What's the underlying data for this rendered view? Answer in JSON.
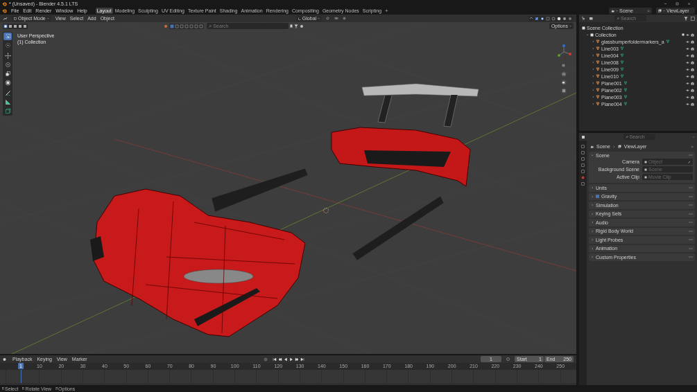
{
  "window": {
    "title": "* (Unsaved) - Blender 4.5.1 LTS"
  },
  "menu": [
    "File",
    "Edit",
    "Render",
    "Window",
    "Help"
  ],
  "workspaces": [
    {
      "label": "Layout",
      "selected": true
    },
    {
      "label": "Modeling",
      "selected": false
    },
    {
      "label": "Sculpting",
      "selected": false
    },
    {
      "label": "UV Editing",
      "selected": false
    },
    {
      "label": "Texture Paint",
      "selected": false
    },
    {
      "label": "Shading",
      "selected": false
    },
    {
      "label": "Animation",
      "selected": false
    },
    {
      "label": "Rendering",
      "selected": false
    },
    {
      "label": "Compositing",
      "selected": false
    },
    {
      "label": "Geometry Nodes",
      "selected": false
    },
    {
      "label": "Scripting",
      "selected": false
    }
  ],
  "add_workspace": "+",
  "scene": "Scene",
  "view_layer": "ViewLayer",
  "viewport": {
    "mode": "Object Mode",
    "menus": [
      "View",
      "Select",
      "Add",
      "Object"
    ],
    "orientation": "Global",
    "search_placeholder": "Search",
    "options": "Options",
    "view_name": "User Perspective",
    "collection": "(1) Collection",
    "tools": [
      {
        "kind": "select",
        "selected": true
      },
      {
        "kind": "cursor",
        "selected": false
      },
      {
        "kind": "move",
        "selected": false
      },
      {
        "kind": "rotate",
        "selected": false
      },
      {
        "kind": "scale",
        "selected": false
      },
      {
        "kind": "transform",
        "selected": false
      },
      {
        "kind": "annotate",
        "selected": false
      },
      {
        "kind": "measure",
        "selected": false
      },
      {
        "kind": "add-cube",
        "selected": false
      }
    ]
  },
  "outliner": {
    "search_placeholder": "Search",
    "root": "Scene Collection",
    "collection": {
      "name": "Collection",
      "expanded": true,
      "children": [
        {
          "name": "glassbumperfoldermarkers_a",
          "expanded": false
        },
        {
          "name": "Line003",
          "expanded": false
        },
        {
          "name": "Line004",
          "expanded": false
        },
        {
          "name": "Line008",
          "expanded": false
        },
        {
          "name": "Line009",
          "expanded": false
        },
        {
          "name": "Line010",
          "expanded": false
        },
        {
          "name": "Plane001",
          "expanded": false
        },
        {
          "name": "Plane002",
          "expanded": false
        },
        {
          "name": "Plane003",
          "expanded": false
        },
        {
          "name": "Plane004",
          "expanded": false
        }
      ]
    }
  },
  "properties": {
    "search_placeholder": "Search",
    "breadcrumb": [
      "Scene",
      "ViewLayer"
    ],
    "section": {
      "title": "Scene",
      "expanded": true,
      "fields": [
        {
          "label": "Camera",
          "placeholder": "Object"
        },
        {
          "label": "Background Scene",
          "placeholder": "Scene"
        },
        {
          "label": "Active Clip",
          "placeholder": "Movie Clip"
        }
      ]
    },
    "panels": [
      {
        "title": "Units",
        "kind": "plain",
        "expanded": false
      },
      {
        "title": "Gravity",
        "kind": "checkbox",
        "checked": true,
        "expanded": false
      },
      {
        "title": "Simulation",
        "kind": "plain",
        "expanded": false
      },
      {
        "title": "Keying Sets",
        "kind": "plain",
        "expanded": false
      },
      {
        "title": "Audio",
        "kind": "plain",
        "expanded": false
      },
      {
        "title": "Rigid Body World",
        "kind": "plain",
        "expanded": false
      },
      {
        "title": "Light Probes",
        "kind": "plain",
        "expanded": false
      },
      {
        "title": "Animation",
        "kind": "plain",
        "expanded": false
      },
      {
        "title": "Custom Properties",
        "kind": "plain",
        "expanded": false
      }
    ]
  },
  "timeline": {
    "menus": [
      "Playback",
      "Keying",
      "View",
      "Marker"
    ],
    "current_frame": "1",
    "start_label": "Start",
    "start": "1",
    "end_label": "End",
    "end": "250",
    "ticks": [
      {
        "label": "1",
        "selected": true
      },
      {
        "label": "10",
        "selected": false
      },
      {
        "label": "20",
        "selected": false
      },
      {
        "label": "30",
        "selected": false
      },
      {
        "label": "40",
        "selected": false
      },
      {
        "label": "50",
        "selected": false
      },
      {
        "label": "60",
        "selected": false
      },
      {
        "label": "70",
        "selected": false
      },
      {
        "label": "80",
        "selected": false
      },
      {
        "label": "90",
        "selected": false
      },
      {
        "label": "100",
        "selected": false
      },
      {
        "label": "110",
        "selected": false
      },
      {
        "label": "120",
        "selected": false
      },
      {
        "label": "130",
        "selected": false
      },
      {
        "label": "140",
        "selected": false
      },
      {
        "label": "150",
        "selected": false
      },
      {
        "label": "160",
        "selected": false
      },
      {
        "label": "170",
        "selected": false
      },
      {
        "label": "180",
        "selected": false
      },
      {
        "label": "190",
        "selected": false
      },
      {
        "label": "200",
        "selected": false
      },
      {
        "label": "210",
        "selected": false
      },
      {
        "label": "220",
        "selected": false
      },
      {
        "label": "230",
        "selected": false
      },
      {
        "label": "240",
        "selected": false
      },
      {
        "label": "250",
        "selected": false
      }
    ]
  },
  "status_bar": [
    "Select",
    "Rotate View",
    "Options"
  ]
}
